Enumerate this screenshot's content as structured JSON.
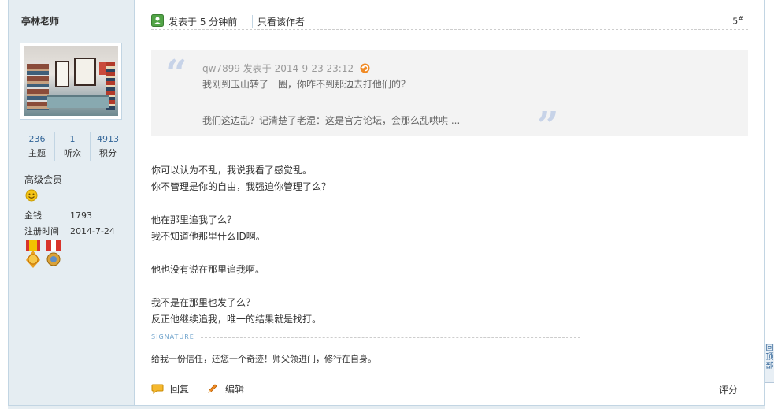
{
  "author": {
    "name": "亭林老师",
    "stats": [
      {
        "value": "236",
        "label": "主题"
      },
      {
        "value": "1",
        "label": "听众"
      },
      {
        "value": "4913",
        "label": "积分"
      }
    ],
    "level": "高级会员",
    "money_label": "金钱",
    "money": "1793",
    "register_label": "注册时间",
    "register_date": "2014-7-24"
  },
  "post": {
    "posted": "发表于 5 分钟前",
    "only_author": "只看该作者",
    "floor": "5",
    "floor_mark": "#",
    "quote": {
      "meta": "qw7899 发表于 2014-9-23 23:12",
      "line1": "我刚到玉山转了一圈，你咋不到那边去打他们的？",
      "line2": "我们这边乱？记清楚了老湿：这是官方论坛，会那么乱哄哄 ..."
    },
    "body": [
      "你可以认为不乱，我说我看了感觉乱。",
      "你不管理是你的自由，我强迫你管理了么？",
      "",
      "他在那里追我了么？",
      "我不知道他那里什么ID啊。",
      "",
      "他也没有说在那里追我啊。",
      "",
      "我不是在那里也发了么？",
      "反正他继续追我，唯一的结果就是找打。"
    ],
    "signature_label": "SIGNATURE",
    "signature": "给我一份信任，还您一个奇迹！师父领进门，修行在自身。",
    "reply": "回复",
    "edit": "编辑",
    "rate": "评分"
  },
  "backtop": [
    "回",
    "顶",
    "部"
  ],
  "colors": {
    "sidebar_bg": "#e5edf2",
    "border": "#c2d5e3",
    "link": "#336699",
    "quote_bg": "#f3f3f3"
  }
}
